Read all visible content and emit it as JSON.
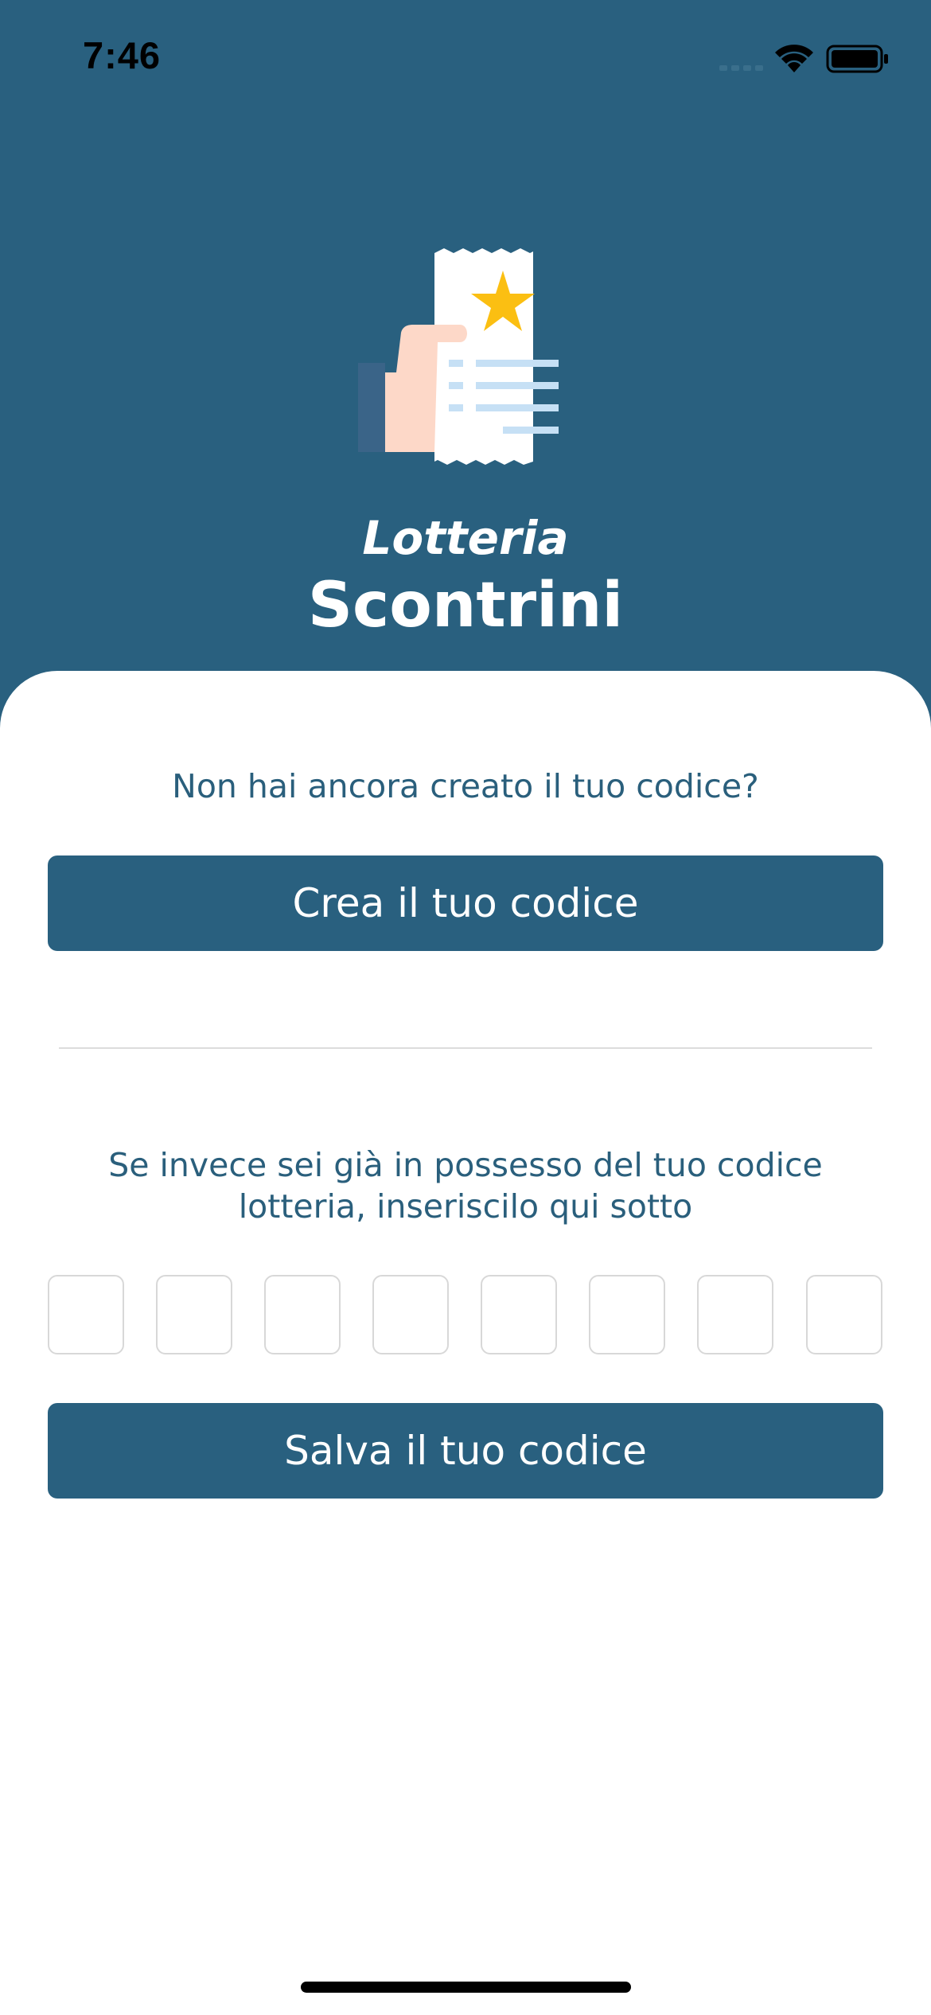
{
  "status_bar": {
    "time": "7:46",
    "icons": [
      "signal-icon",
      "wifi-icon",
      "battery-icon"
    ]
  },
  "hero": {
    "illustration": "hand-holding-receipt-with-star",
    "title_top": "Lotteria",
    "title_main": "Scontrini"
  },
  "create_section": {
    "prompt": "Non hai ancora creato il tuo codice?",
    "button_label": "Crea il tuo codice"
  },
  "existing_section": {
    "prompt_line1": "Se invece sei già in possesso del tuo codice",
    "prompt_line2": "lotteria, inseriscilo qui sotto",
    "code_cells": [
      "",
      "",
      "",
      "",
      "",
      "",
      "",
      ""
    ],
    "button_label": "Salva il tuo codice"
  },
  "colors": {
    "brand": "#29607f",
    "text": "#2a5f7c",
    "background": "#ffffff",
    "star": "#fbbf12",
    "skin": "#fdd8c8",
    "receipt_lines": "#c6e0f5"
  }
}
